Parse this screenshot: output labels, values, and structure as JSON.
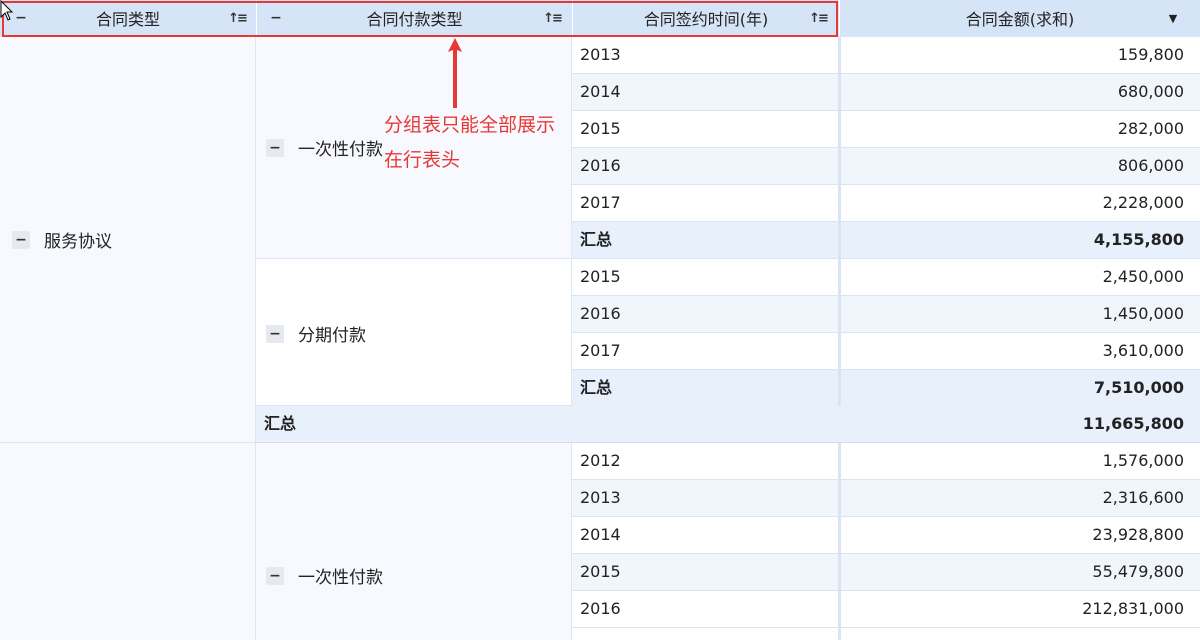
{
  "header": {
    "col1": "合同类型",
    "col2": "合同付款类型",
    "col3": "合同签约时间(年)",
    "col4": "合同金额(求和)",
    "collapse_glyph": "−",
    "sort_glyph": "↑≡",
    "dropdown_glyph": "▼"
  },
  "annotation": {
    "line1": "分组表只能全部展示",
    "line2": "在行表头",
    "color": "#e53935"
  },
  "groups": [
    {
      "type": "服务协议",
      "subgroups": [
        {
          "payment_type": "一次性付款",
          "rows": [
            {
              "year": "2013",
              "amount": "159,800"
            },
            {
              "year": "2014",
              "amount": "680,000"
            },
            {
              "year": "2015",
              "amount": "282,000"
            },
            {
              "year": "2016",
              "amount": "806,000"
            },
            {
              "year": "2017",
              "amount": "2,228,000"
            }
          ],
          "subtotal_label": "汇总",
          "subtotal": "4,155,800"
        },
        {
          "payment_type": "分期付款",
          "rows": [
            {
              "year": "2015",
              "amount": "2,450,000"
            },
            {
              "year": "2016",
              "amount": "1,450,000"
            },
            {
              "year": "2017",
              "amount": "3,610,000"
            }
          ],
          "subtotal_label": "汇总",
          "subtotal": "7,510,000"
        }
      ],
      "total_label": "汇总",
      "total": "11,665,800"
    },
    {
      "type": "",
      "subgroups": [
        {
          "payment_type": "一次性付款",
          "rows": [
            {
              "year": "2012",
              "amount": "1,576,000"
            },
            {
              "year": "2013",
              "amount": "2,316,600"
            },
            {
              "year": "2014",
              "amount": "23,928,800"
            },
            {
              "year": "2015",
              "amount": "55,479,800"
            },
            {
              "year": "2016",
              "amount": "212,831,000"
            }
          ]
        }
      ]
    }
  ]
}
